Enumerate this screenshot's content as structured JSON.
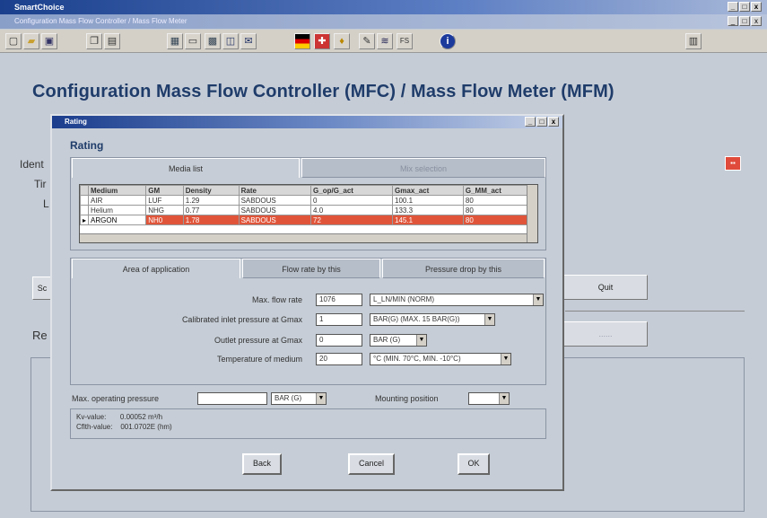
{
  "app": {
    "title": "SmartChoice",
    "doc_title": "Configuration Mass Flow Controller / Mass Flow Meter"
  },
  "window_controls": {
    "min": "_",
    "max": "□",
    "close": "x"
  },
  "toolbar": {
    "icons": [
      "new-icon",
      "open-icon",
      "save-icon",
      "copy-icon",
      "paste-icon",
      "chart-icon",
      "print-icon",
      "grid-icon",
      "window-icon",
      "mail-icon",
      "flag-de-icon",
      "flag-uk-icon",
      "pin-icon",
      "tools-icon",
      "fs-icon",
      "info-icon",
      "exit-icon"
    ],
    "fs_label": "FS"
  },
  "page": {
    "heading": "Configuration Mass Flow Controller (MFC) / Mass Flow Meter (MFM)",
    "left_labels": [
      "Ident",
      "Tir",
      "L",
      "Sc",
      "Re"
    ],
    "quit": "Quit",
    "disabled_btn": "......"
  },
  "dialog": {
    "title": "Rating",
    "heading": "Rating",
    "tabs_top": [
      {
        "label": "Media list"
      },
      {
        "label": "Mix selection"
      }
    ],
    "table": {
      "columns": [
        "Medium",
        "GM",
        "Density",
        "Rate",
        "G_op/G_act",
        "Gmax_act",
        "G_MM_act"
      ],
      "rows": [
        {
          "name": "AIR",
          "gm": "LUF",
          "density": "1.29",
          "rate": "SABDOUS",
          "g1": "0",
          "g2": "100.1",
          "g3": "80"
        },
        {
          "name": "Helium",
          "gm": "NHG",
          "density": "0.77",
          "rate": "SABDOUS",
          "g1": "4.0",
          "g2": "133.3",
          "g3": "80"
        },
        {
          "name": "ARGON",
          "gm": "NH0",
          "density": "1.78",
          "rate": "SABDOUS",
          "g1": "72",
          "g2": "145.1",
          "g3": "80"
        }
      ]
    },
    "tabs_mid": [
      {
        "label": "Area of application"
      },
      {
        "label": "Flow rate by this"
      },
      {
        "label": "Pressure drop by this"
      }
    ],
    "form": [
      {
        "label": "Max. flow rate",
        "value": "1076",
        "unit": "L_LN/MIN (NORM)"
      },
      {
        "label": "Calibrated inlet pressure at Gmax",
        "value": "1",
        "unit": "BAR(G) (MAX. 15 BAR(G))"
      },
      {
        "label": "Outlet pressure at Gmax",
        "value": "0",
        "unit": "BAR (G)"
      },
      {
        "label": "Temperature of medium",
        "value": "20",
        "unit": "°C (MIN. 70°C, MIN. -10°C)"
      }
    ],
    "max_op_label": "Max. operating pressure",
    "max_op_unit": "BAR (G)",
    "mount_label": "Mounting position",
    "info": [
      "Kv-value:       0.00052 m³/h",
      "Cflth-value:    001.0702E (hm)"
    ],
    "buttons": {
      "back": "Back",
      "cancel": "Cancel",
      "ok": "OK"
    }
  },
  "colors": {
    "accent": "#1f3c6a",
    "selected_row": "#e0553a",
    "close_red": "#e04a3a"
  }
}
